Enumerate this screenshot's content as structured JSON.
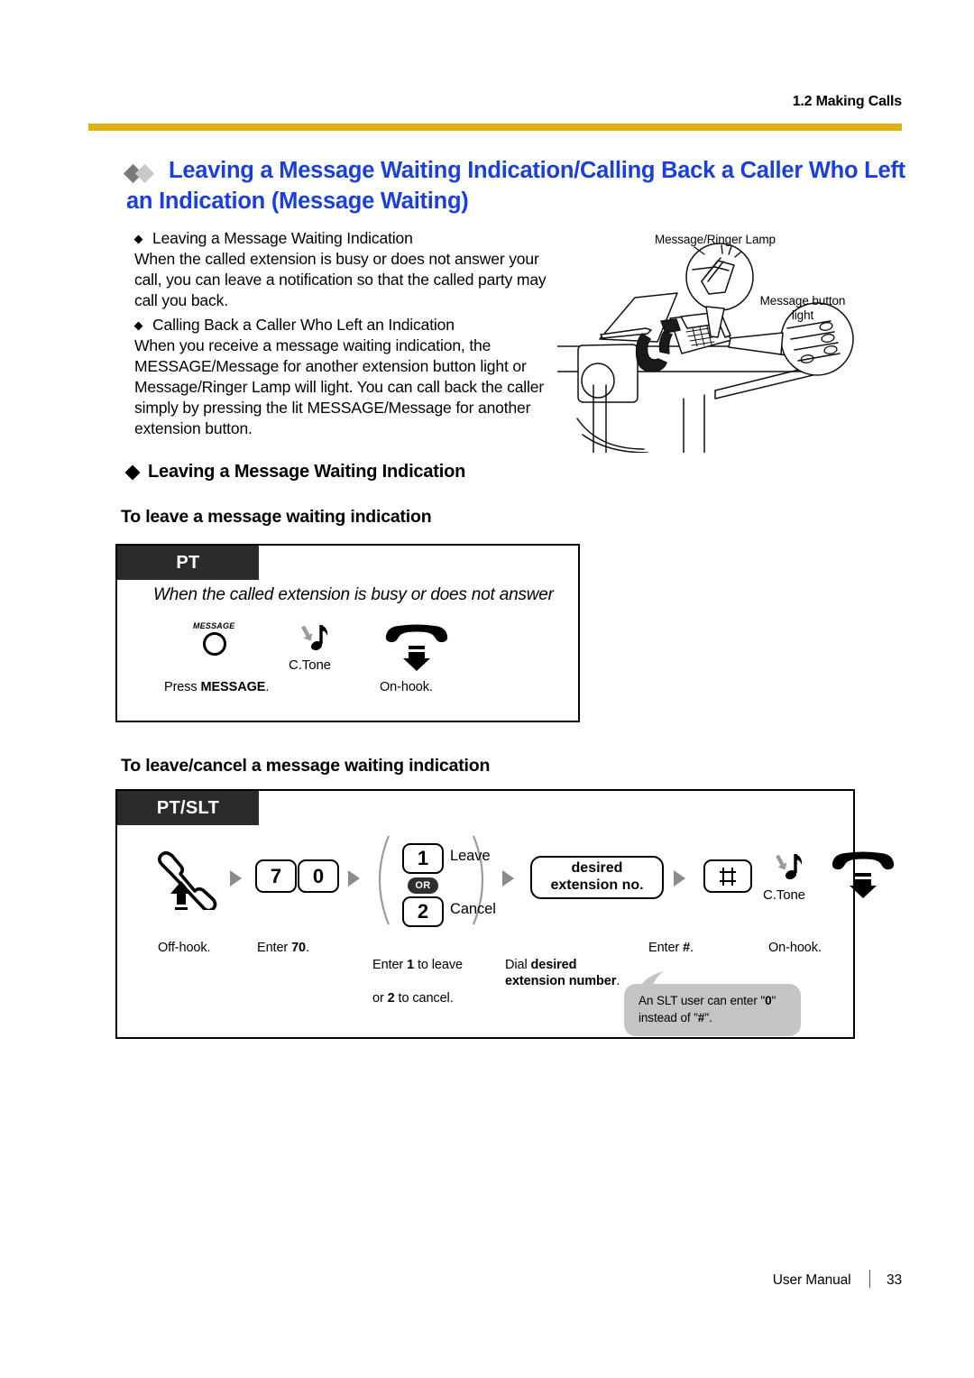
{
  "header": {
    "chapter": "1.2 Making Calls",
    "rule_color": "#e0b20c"
  },
  "title": {
    "text": "Leaving a Message Waiting Indication/Calling Back a Caller Who Left an Indication (Message Waiting)",
    "color": "#1a3fe0",
    "diamond_dark": "#7a7a7a",
    "diamond_light": "#c9c9c9"
  },
  "intro": {
    "item1_heading": "Leaving a Message Waiting Indication",
    "item1_body": "When the called extension is busy or does not answer your call, you can leave a notification so that the called party may call you back.",
    "item2_heading": "Calling Back a Caller Who Left an Indication",
    "item2_body": "When you receive a message waiting indication, the MESSAGE/Message for another extension button light or Message/Ringer Lamp will light. You can call back the caller simply by pressing the lit MESSAGE/Message for another extension button."
  },
  "illustration": {
    "label_lamp": "Message/Ringer Lamp",
    "label_message_button": "Message button\nlight"
  },
  "section1": {
    "heading": "Leaving a Message Waiting Indication",
    "subheading": "To leave a message waiting indication",
    "box": {
      "tag": "PT",
      "condition": "When the called extension is busy or does not answer",
      "message_button_label": "MESSAGE",
      "tone_label": "C.Tone",
      "caption_press": "Press MESSAGE.",
      "caption_press_plain": "Press ",
      "caption_press_bold": "MESSAGE",
      "caption_press_tail": ".",
      "caption_onhook": "On-hook."
    }
  },
  "section2": {
    "subheading": "To leave/cancel a message waiting indication",
    "box": {
      "tag": "PT/SLT",
      "key_7": "7",
      "key_0": "0",
      "key_1": "1",
      "key_2": "2",
      "or_label": "OR",
      "choice_leave": "Leave",
      "choice_cancel": "Cancel",
      "ext_box_line1": "desired",
      "ext_box_line2": "extension no.",
      "hash_key": "#",
      "tone_label": "C.Tone",
      "caption_offhook": "Off-hook.",
      "caption_enter70_plain": "Enter ",
      "caption_enter70_bold": "70",
      "caption_enter70_tail": ".",
      "caption_choice_l1_a": "Enter ",
      "caption_choice_l1_b": "1",
      "caption_choice_l1_c": " to leave",
      "caption_choice_l2_a": "or ",
      "caption_choice_l2_b": "2",
      "caption_choice_l2_c": " to cancel.",
      "caption_dial_a": "Dial ",
      "caption_dial_b": "desired",
      "caption_dial_c": "extension number",
      "caption_dial_d": ".",
      "caption_hash_a": "Enter ",
      "caption_hash_b": "#",
      "caption_hash_c": ".",
      "caption_onhook": "On-hook.",
      "bubble_line1_a": "An SLT user can enter \"",
      "bubble_line1_b": "0",
      "bubble_line1_c": "\"",
      "bubble_line2_a": "instead of \"",
      "bubble_line2_b": "#",
      "bubble_line2_c": "\"."
    }
  },
  "footer": {
    "manual": "User Manual",
    "page": "33"
  }
}
